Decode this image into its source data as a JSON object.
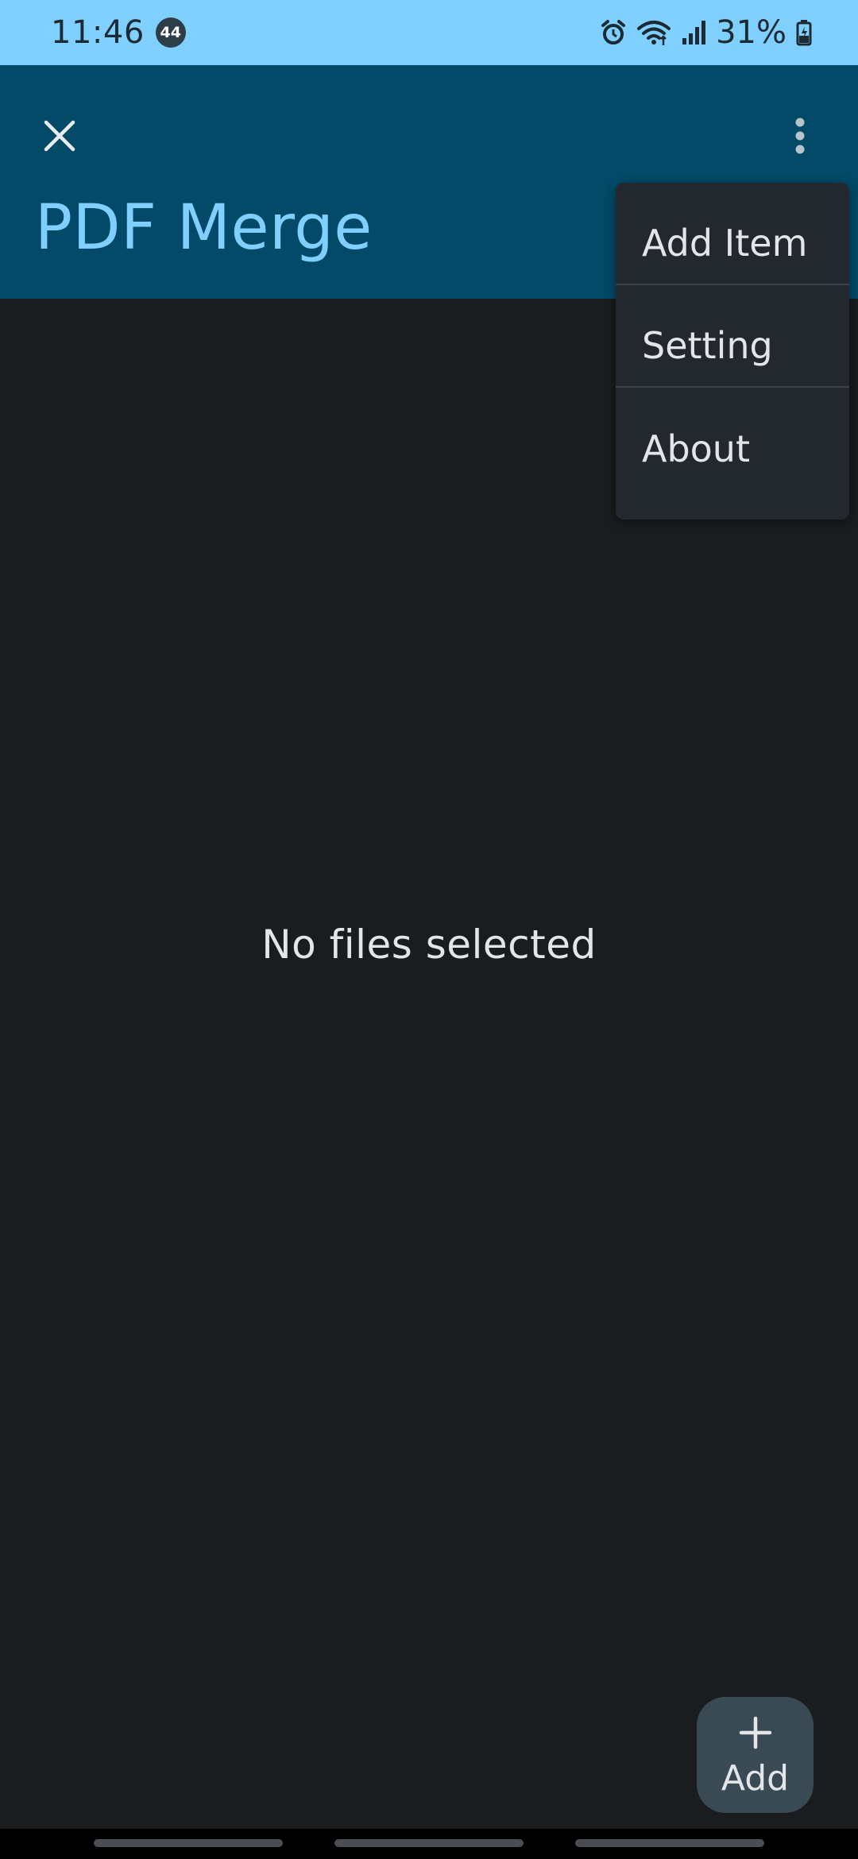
{
  "status_bar": {
    "time": "11:46",
    "notification_count": "44",
    "battery": "31%",
    "icons": [
      "alarm-icon",
      "wifi-icon",
      "signal-icon",
      "battery-icon"
    ]
  },
  "app_bar": {
    "title": "PDF Merge",
    "close_icon": "close-icon",
    "more_icon": "more-vert-icon"
  },
  "menu": {
    "items": [
      {
        "label": "Add Item"
      },
      {
        "label": "Setting"
      },
      {
        "label": "About"
      }
    ]
  },
  "main": {
    "empty_text": "No files selected"
  },
  "fab": {
    "label": "Add",
    "icon": "plus-icon"
  },
  "colors": {
    "status_bar_bg": "#7fd0ff",
    "app_bar_bg": "#024a68",
    "title_color": "#7fd0ff",
    "background": "#1a1c1e",
    "menu_bg": "#23282e",
    "fab_bg": "#3a4a55"
  }
}
